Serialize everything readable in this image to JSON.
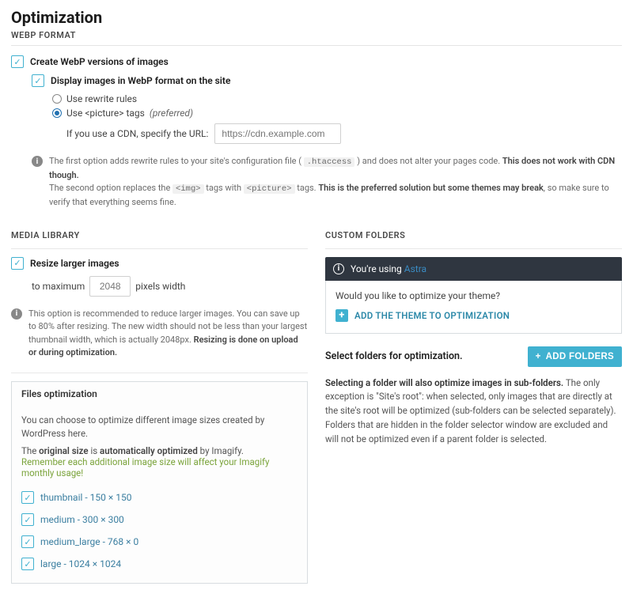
{
  "page": {
    "title": "Optimization"
  },
  "webp": {
    "section_label": "WEBP FORMAT",
    "create_label": "Create WebP versions of images",
    "display_label": "Display images in WebP format on the site",
    "radio_rewrite": "Use rewrite rules",
    "radio_picture": "Use <picture> tags",
    "preferred": "(preferred)",
    "cdn_label": "If you use a CDN, specify the URL:",
    "cdn_placeholder": "https://cdn.example.com",
    "info_line1_a": "The first option adds rewrite rules to your site's configuration file (",
    "info_htaccess": ".htaccess",
    "info_line1_b": ") and does not alter your pages code.",
    "info_line1_bold": "This does not work with CDN though.",
    "info_line2_a": "The second option replaces the",
    "info_img": "<img>",
    "info_line2_b": "tags with",
    "info_picture": "<picture>",
    "info_line2_c": "tags.",
    "info_line2_bold": "This is the preferred solution but some themes may break",
    "info_line2_d": ", so make sure to verify that everything seems fine."
  },
  "media": {
    "section_label": "MEDIA LIBRARY",
    "resize_label": "Resize larger images",
    "to_max": "to maximum",
    "px_value": "2048",
    "px_width": "pixels width",
    "info_a": "This option is recommended to reduce larger images. You can save up to 80% after resizing. The new width should not be less than your largest thumbnail width, which is actually 2048px.",
    "info_bold": "Resizing is done on upload or during optimization."
  },
  "files": {
    "header": "Files optimization",
    "desc": "You can choose to optimize different image sizes created by WordPress here.",
    "auto_a": "The",
    "auto_b": "original size",
    "auto_c": "is",
    "auto_d": "automatically optimized",
    "auto_e": "by Imagify.",
    "warn": "Remember each additional image size will affect your Imagify monthly usage!",
    "sizes": [
      {
        "label": "thumbnail - 150 × 150"
      },
      {
        "label": "medium - 300 × 300"
      },
      {
        "label": "medium_large - 768 × 0"
      },
      {
        "label": "large - 1024 × 1024"
      }
    ]
  },
  "custom": {
    "section_label": "CUSTOM FOLDERS",
    "using": "You're using",
    "theme": "Astra",
    "question": "Would you like to optimize your theme?",
    "add_theme": "ADD THE THEME TO OPTIMIZATION",
    "select_label": "Select folders for optimization.",
    "add_folders": "ADD FOLDERS",
    "desc_lead": "Selecting a folder will also optimize images in sub-folders.",
    "desc_a": "The only exception is \"Site's root\": when selected, only images that are directly at the site's root will be optimized (sub-folders can be selected separately).",
    "desc_b": "Folders that are hidden in the folder selector window are excluded and will not be optimized even if a parent folder is selected."
  }
}
